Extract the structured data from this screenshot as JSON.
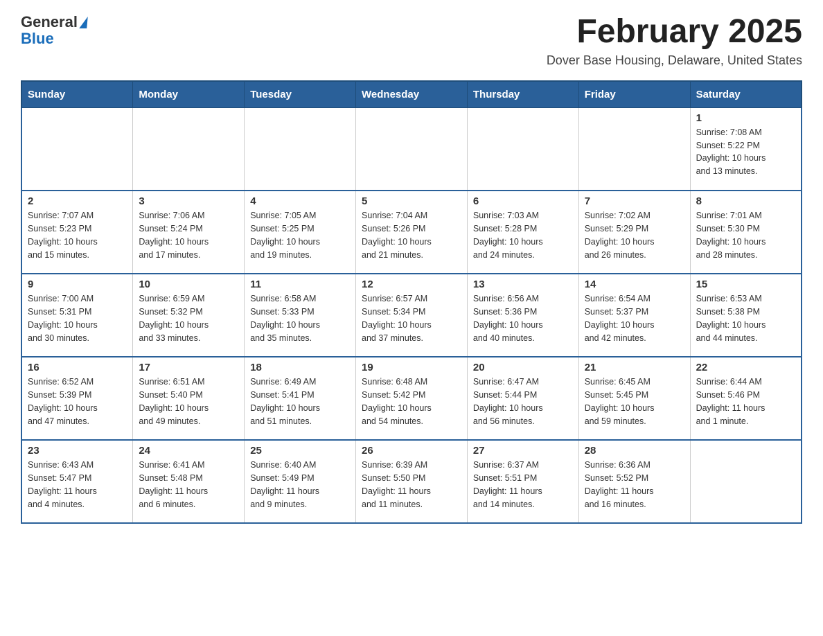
{
  "header": {
    "logo_general": "General",
    "logo_blue": "Blue",
    "month_title": "February 2025",
    "location": "Dover Base Housing, Delaware, United States"
  },
  "days_of_week": [
    "Sunday",
    "Monday",
    "Tuesday",
    "Wednesday",
    "Thursday",
    "Friday",
    "Saturday"
  ],
  "weeks": [
    [
      {
        "day": "",
        "info": ""
      },
      {
        "day": "",
        "info": ""
      },
      {
        "day": "",
        "info": ""
      },
      {
        "day": "",
        "info": ""
      },
      {
        "day": "",
        "info": ""
      },
      {
        "day": "",
        "info": ""
      },
      {
        "day": "1",
        "info": "Sunrise: 7:08 AM\nSunset: 5:22 PM\nDaylight: 10 hours\nand 13 minutes."
      }
    ],
    [
      {
        "day": "2",
        "info": "Sunrise: 7:07 AM\nSunset: 5:23 PM\nDaylight: 10 hours\nand 15 minutes."
      },
      {
        "day": "3",
        "info": "Sunrise: 7:06 AM\nSunset: 5:24 PM\nDaylight: 10 hours\nand 17 minutes."
      },
      {
        "day": "4",
        "info": "Sunrise: 7:05 AM\nSunset: 5:25 PM\nDaylight: 10 hours\nand 19 minutes."
      },
      {
        "day": "5",
        "info": "Sunrise: 7:04 AM\nSunset: 5:26 PM\nDaylight: 10 hours\nand 21 minutes."
      },
      {
        "day": "6",
        "info": "Sunrise: 7:03 AM\nSunset: 5:28 PM\nDaylight: 10 hours\nand 24 minutes."
      },
      {
        "day": "7",
        "info": "Sunrise: 7:02 AM\nSunset: 5:29 PM\nDaylight: 10 hours\nand 26 minutes."
      },
      {
        "day": "8",
        "info": "Sunrise: 7:01 AM\nSunset: 5:30 PM\nDaylight: 10 hours\nand 28 minutes."
      }
    ],
    [
      {
        "day": "9",
        "info": "Sunrise: 7:00 AM\nSunset: 5:31 PM\nDaylight: 10 hours\nand 30 minutes."
      },
      {
        "day": "10",
        "info": "Sunrise: 6:59 AM\nSunset: 5:32 PM\nDaylight: 10 hours\nand 33 minutes."
      },
      {
        "day": "11",
        "info": "Sunrise: 6:58 AM\nSunset: 5:33 PM\nDaylight: 10 hours\nand 35 minutes."
      },
      {
        "day": "12",
        "info": "Sunrise: 6:57 AM\nSunset: 5:34 PM\nDaylight: 10 hours\nand 37 minutes."
      },
      {
        "day": "13",
        "info": "Sunrise: 6:56 AM\nSunset: 5:36 PM\nDaylight: 10 hours\nand 40 minutes."
      },
      {
        "day": "14",
        "info": "Sunrise: 6:54 AM\nSunset: 5:37 PM\nDaylight: 10 hours\nand 42 minutes."
      },
      {
        "day": "15",
        "info": "Sunrise: 6:53 AM\nSunset: 5:38 PM\nDaylight: 10 hours\nand 44 minutes."
      }
    ],
    [
      {
        "day": "16",
        "info": "Sunrise: 6:52 AM\nSunset: 5:39 PM\nDaylight: 10 hours\nand 47 minutes."
      },
      {
        "day": "17",
        "info": "Sunrise: 6:51 AM\nSunset: 5:40 PM\nDaylight: 10 hours\nand 49 minutes."
      },
      {
        "day": "18",
        "info": "Sunrise: 6:49 AM\nSunset: 5:41 PM\nDaylight: 10 hours\nand 51 minutes."
      },
      {
        "day": "19",
        "info": "Sunrise: 6:48 AM\nSunset: 5:42 PM\nDaylight: 10 hours\nand 54 minutes."
      },
      {
        "day": "20",
        "info": "Sunrise: 6:47 AM\nSunset: 5:44 PM\nDaylight: 10 hours\nand 56 minutes."
      },
      {
        "day": "21",
        "info": "Sunrise: 6:45 AM\nSunset: 5:45 PM\nDaylight: 10 hours\nand 59 minutes."
      },
      {
        "day": "22",
        "info": "Sunrise: 6:44 AM\nSunset: 5:46 PM\nDaylight: 11 hours\nand 1 minute."
      }
    ],
    [
      {
        "day": "23",
        "info": "Sunrise: 6:43 AM\nSunset: 5:47 PM\nDaylight: 11 hours\nand 4 minutes."
      },
      {
        "day": "24",
        "info": "Sunrise: 6:41 AM\nSunset: 5:48 PM\nDaylight: 11 hours\nand 6 minutes."
      },
      {
        "day": "25",
        "info": "Sunrise: 6:40 AM\nSunset: 5:49 PM\nDaylight: 11 hours\nand 9 minutes."
      },
      {
        "day": "26",
        "info": "Sunrise: 6:39 AM\nSunset: 5:50 PM\nDaylight: 11 hours\nand 11 minutes."
      },
      {
        "day": "27",
        "info": "Sunrise: 6:37 AM\nSunset: 5:51 PM\nDaylight: 11 hours\nand 14 minutes."
      },
      {
        "day": "28",
        "info": "Sunrise: 6:36 AM\nSunset: 5:52 PM\nDaylight: 11 hours\nand 16 minutes."
      },
      {
        "day": "",
        "info": ""
      }
    ]
  ]
}
